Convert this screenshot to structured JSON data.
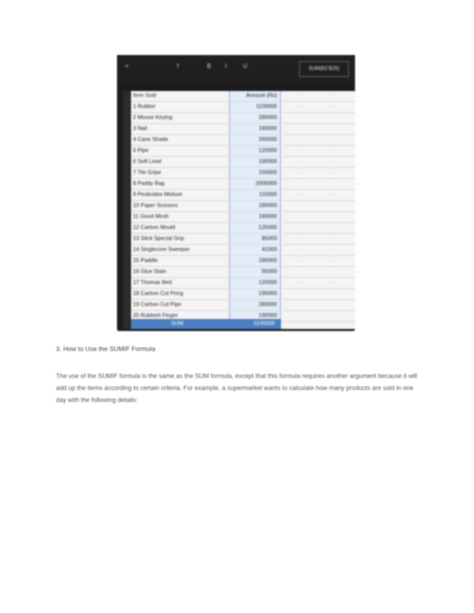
{
  "toolbar": {
    "items": [
      "=",
      "f",
      "B",
      "I",
      "U"
    ],
    "name_box": "SUM(B2:B25)"
  },
  "sheet": {
    "header": {
      "name": "Item Sold",
      "value": "Amount (Rs)"
    },
    "rows": [
      {
        "name": "1 Rubber",
        "value": "1100000"
      },
      {
        "name": "2 Mouse Keying",
        "value": "280000"
      },
      {
        "name": "3 Nail",
        "value": "180000"
      },
      {
        "name": "4 Cane Shade",
        "value": "260000"
      },
      {
        "name": "5 Pipe",
        "value": "120000"
      },
      {
        "name": "6 Soft Lead",
        "value": "190000"
      },
      {
        "name": "7 Tile Gripe",
        "value": "150000"
      },
      {
        "name": "8 Paddy Bag",
        "value": "2000000"
      },
      {
        "name": "9 Pesticides Mixture",
        "value": "110000"
      },
      {
        "name": "10 Paper Scissors",
        "value": "180000"
      },
      {
        "name": "11 Good Mesh",
        "value": "180000"
      },
      {
        "name": "12 Carbon Mould",
        "value": "125000"
      },
      {
        "name": "13 Stick Special Grip",
        "value": "85000"
      },
      {
        "name": "14 Singlecore Sweeper",
        "value": "41000"
      },
      {
        "name": "15 Paddle",
        "value": "180000"
      },
      {
        "name": "16 Glue Stain",
        "value": "55000"
      },
      {
        "name": "17 Thomas Bed",
        "value": "120000"
      },
      {
        "name": "18 Carbon Cut Pring",
        "value": "190000"
      },
      {
        "name": "19 Carbon Cut Pipe",
        "value": "280000"
      },
      {
        "name": "20 Rubbish Finger",
        "value": "190000"
      }
    ],
    "total": {
      "label": "SUM",
      "value": "5245000"
    }
  },
  "section": {
    "heading": "3. How to Use the SUMIF Formula",
    "paragraph": "The use of the SUMIF formula is the same as the SUM formula, except that this formula requires another argument because it will add up the items according to certain criteria. For example, a supermarket wants to calculate how many products are sold in one day with the following details:"
  }
}
